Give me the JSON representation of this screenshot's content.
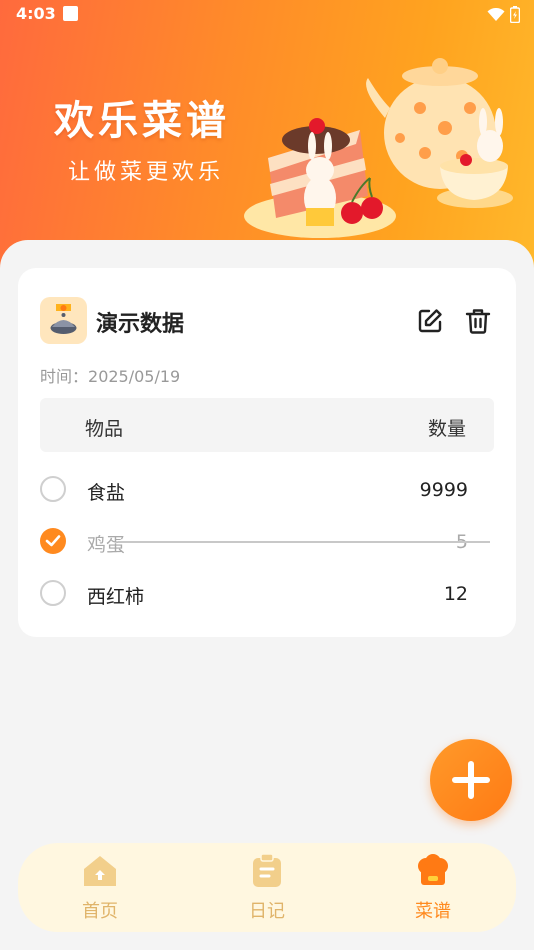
{
  "status_bar": {
    "time": "4:03"
  },
  "hero": {
    "title": "欢乐菜谱",
    "subtitle": "让做菜更欢乐"
  },
  "recipe": {
    "name": "演示数据",
    "time_label": "时间：",
    "time_value": "2025/05/19",
    "columns": {
      "item": "物品",
      "quantity": "数量"
    },
    "items": [
      {
        "name": "食盐",
        "quantity": "9999",
        "checked": false
      },
      {
        "name": "鸡蛋",
        "quantity": "5",
        "checked": true
      },
      {
        "name": "西红柿",
        "quantity": "12",
        "checked": false
      }
    ]
  },
  "nav": {
    "items": [
      {
        "label": "首页",
        "icon": "home-icon",
        "active": false
      },
      {
        "label": "日记",
        "icon": "clipboard-icon",
        "active": false
      },
      {
        "label": "菜谱",
        "icon": "chef-hat-icon",
        "active": true
      }
    ]
  },
  "colors": {
    "accent": "#ff8a1f",
    "nav_inactive": "#e0b46a",
    "nav_bg": "#fff7e0"
  }
}
